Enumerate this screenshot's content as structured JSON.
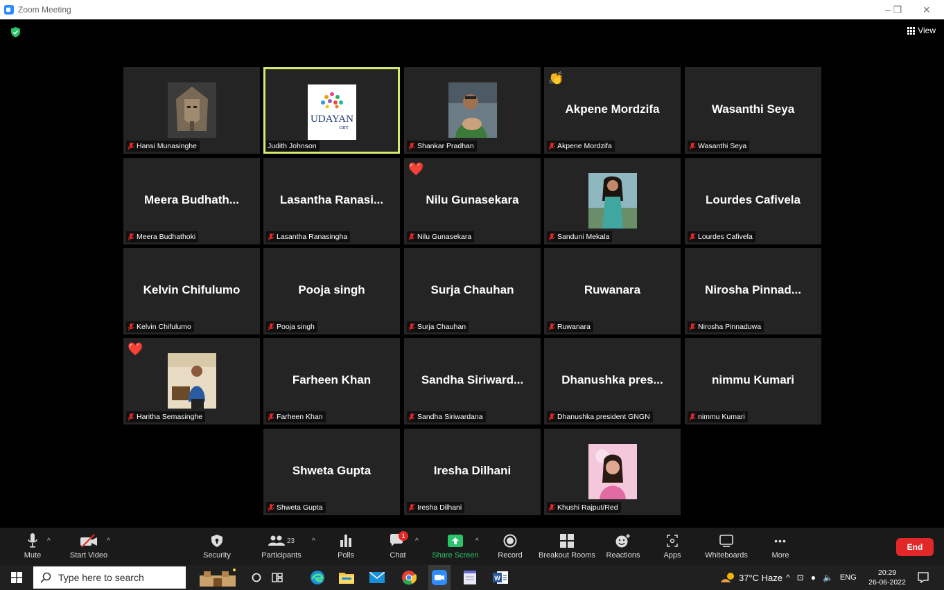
{
  "window": {
    "title": "Zoom Meeting"
  },
  "header": {
    "view_label": "View"
  },
  "tiles": [
    {
      "big": "",
      "tag": "Hansi Munasinghe",
      "avatar": "pharaoh"
    },
    {
      "big": "",
      "tag": "Judith Johnson",
      "avatar": "udayan",
      "active": true,
      "logo_text": "UDAYAN",
      "logo_sub": "care"
    },
    {
      "big": "",
      "tag": "Shankar Pradhan",
      "avatar": "person-cat"
    },
    {
      "big": "Akpene Mordzifa",
      "tag": "Akpene Mordzifa",
      "reaction": "👏"
    },
    {
      "big": "Wasanthi Seya",
      "tag": "Wasanthi Seya"
    },
    {
      "big": "Meera  Budhath...",
      "tag": "Meera Budhathoki"
    },
    {
      "big": "Lasantha  Ranasi...",
      "tag": "Lasantha Ranasingha"
    },
    {
      "big": "Nilu Gunasekara",
      "tag": "Nilu Gunasekara",
      "reaction": "❤️"
    },
    {
      "big": "",
      "tag": "Sanduni Mekala",
      "avatar": "woman-teal"
    },
    {
      "big": "Lourdes Cafivela",
      "tag": "Lourdes Cafivela"
    },
    {
      "big": "Kelvin Chifulumo",
      "tag": "Kelvin Chifulumo"
    },
    {
      "big": "Pooja singh",
      "tag": "Pooja singh"
    },
    {
      "big": "Surja Chauhan",
      "tag": "Surja Chauhan"
    },
    {
      "big": "Ruwanara",
      "tag": "Ruwanara"
    },
    {
      "big": "Nirosha  Pinnad...",
      "tag": "Nirosha Pinnaduwa"
    },
    {
      "big": "",
      "tag": "Haritha Semasinghe",
      "avatar": "man-office",
      "reaction": "❤️"
    },
    {
      "big": "Farheen Khan",
      "tag": "Farheen Khan"
    },
    {
      "big": "Sandha  Siriward...",
      "tag": "Sandha Siriwardana"
    },
    {
      "big": "Dhanushka  pres...",
      "tag": "Dhanushka president  GNGN"
    },
    {
      "big": "nimmu Kumari",
      "tag": "nimmu Kumari"
    },
    {
      "big": "Shweta Gupta",
      "tag": "Shweta Gupta"
    },
    {
      "big": "Iresha Dilhani",
      "tag": "Iresha Dilhani"
    },
    {
      "big": "",
      "tag": "Khushi Rajput/Red",
      "avatar": "girl-pink"
    }
  ],
  "toolbar": {
    "mute": "Mute",
    "start_video": "Start Video",
    "security": "Security",
    "participants": "Participants",
    "participants_count": "23",
    "polls": "Polls",
    "chat": "Chat",
    "chat_badge": "1",
    "share_screen": "Share Screen",
    "record": "Record",
    "breakout_rooms": "Breakout Rooms",
    "reactions": "Reactions",
    "apps": "Apps",
    "whiteboards": "Whiteboards",
    "more": "More",
    "end": "End"
  },
  "taskbar": {
    "search_placeholder": "Type here to search",
    "weather": "37°C  Haze",
    "lang": "ENG",
    "time": "20:29",
    "date": "26-06-2022"
  },
  "colors": {
    "accent_green": "#29C46A",
    "end_red": "#E02828",
    "active_border": "#D8E86A",
    "zoom_blue": "#2D8CFF"
  }
}
